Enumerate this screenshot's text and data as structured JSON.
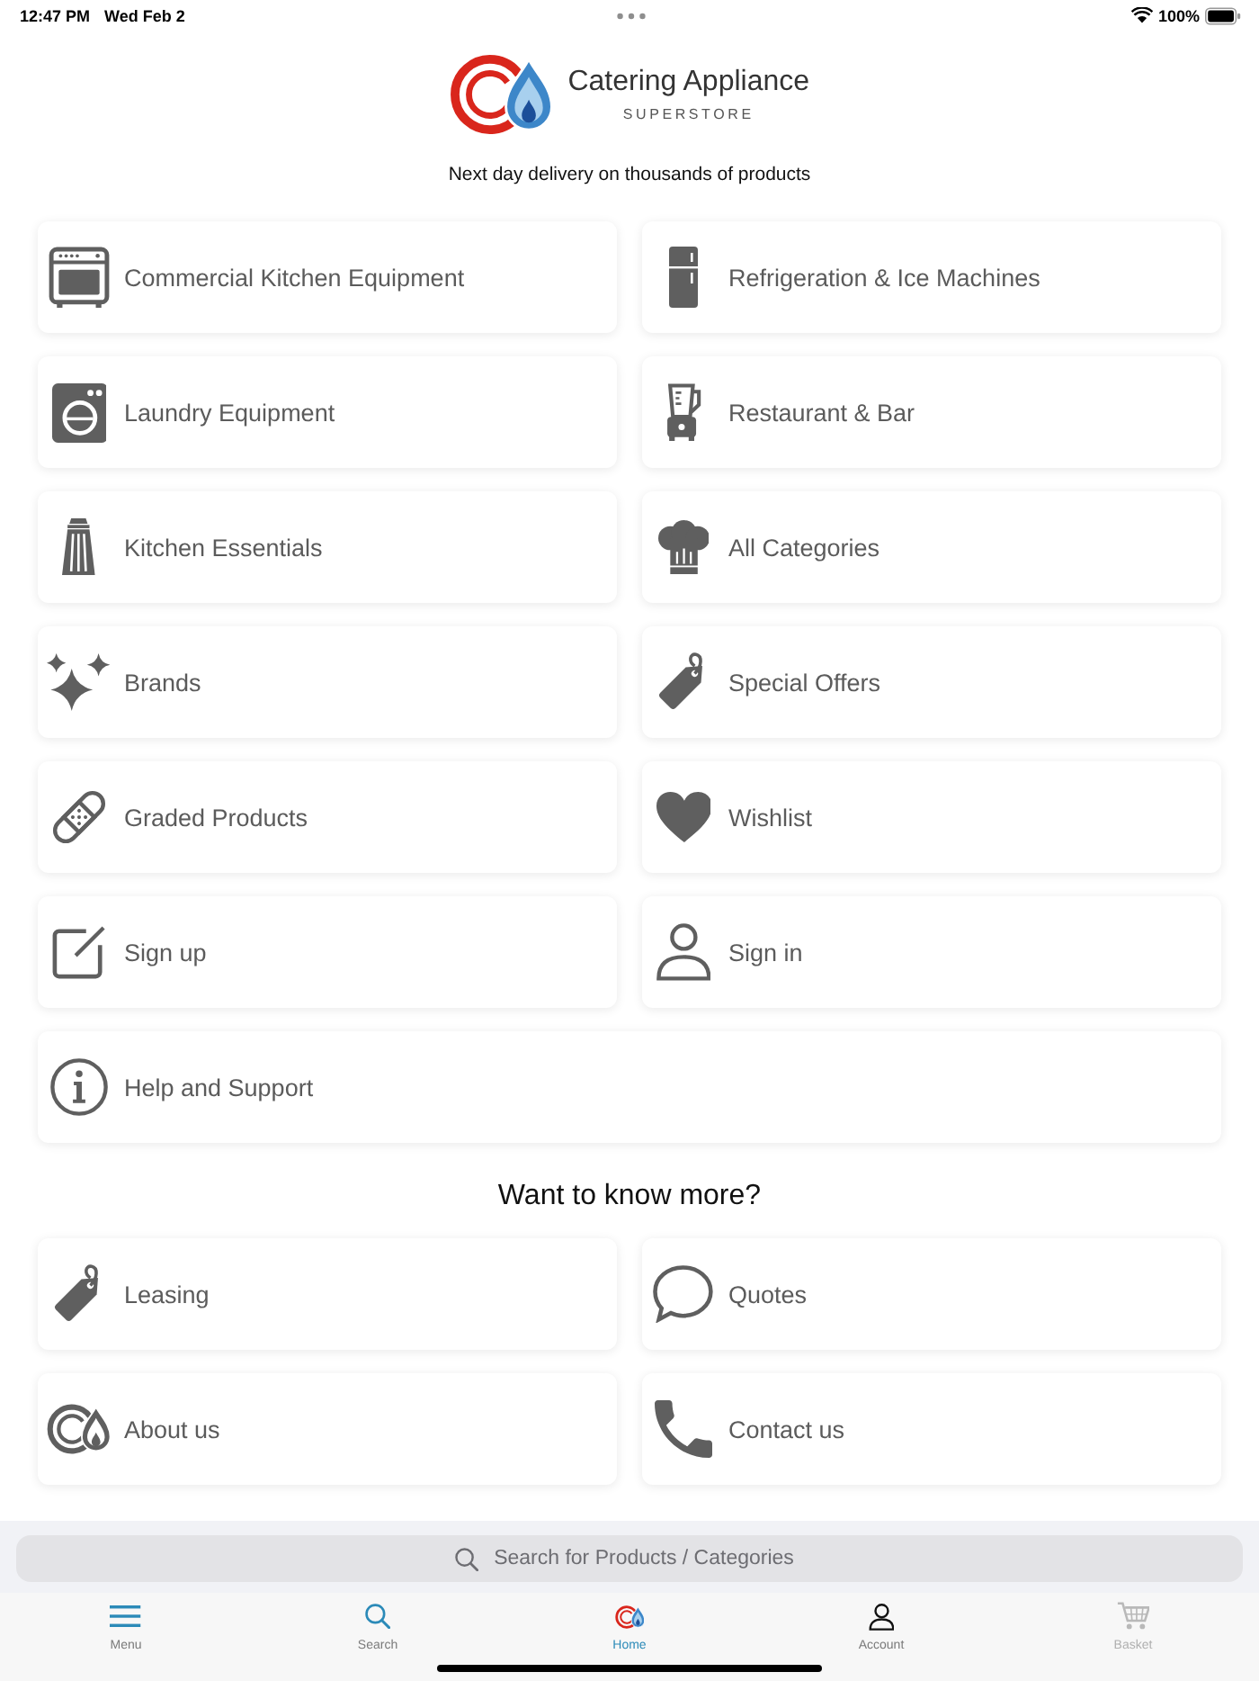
{
  "status_bar": {
    "time": "12:47 PM",
    "date": "Wed Feb 2",
    "battery": "100%"
  },
  "logo": {
    "title": "Catering Appliance",
    "subtitle": "SUPERSTORE"
  },
  "tagline": "Next day delivery on thousands of products",
  "menu": [
    {
      "label": "Commercial Kitchen Equipment",
      "kind": "oven",
      "full_width": false
    },
    {
      "label": "Refrigeration & Ice Machines",
      "kind": "fridge",
      "full_width": false
    },
    {
      "label": "Laundry Equipment",
      "kind": "washer",
      "full_width": false
    },
    {
      "label": "Restaurant & Bar",
      "kind": "blender",
      "full_width": false
    },
    {
      "label": "Kitchen Essentials",
      "kind": "shaker",
      "full_width": false
    },
    {
      "label": "All Categories",
      "kind": "chef-hat",
      "full_width": false
    },
    {
      "label": "Brands",
      "kind": "sparkles",
      "full_width": false
    },
    {
      "label": "Special Offers",
      "kind": "tag",
      "full_width": false
    },
    {
      "label": "Graded Products",
      "kind": "bandage",
      "full_width": false
    },
    {
      "label": "Wishlist",
      "kind": "heart",
      "full_width": false
    },
    {
      "label": "Sign up",
      "kind": "edit",
      "full_width": false
    },
    {
      "label": "Sign in",
      "kind": "person",
      "full_width": false
    },
    {
      "label": "Help and Support",
      "kind": "info",
      "full_width": true
    }
  ],
  "more": {
    "heading": "Want to know more?",
    "items": [
      {
        "label": "Leasing",
        "kind": "tag"
      },
      {
        "label": "Quotes",
        "kind": "speech"
      },
      {
        "label": "About us",
        "kind": "logo"
      },
      {
        "label": "Contact us",
        "kind": "phone"
      }
    ]
  },
  "search": {
    "placeholder": "Search for Products / Categories"
  },
  "tab_bar": [
    {
      "label": "Menu",
      "kind": "menu",
      "selected": false,
      "disabled": false
    },
    {
      "label": "Search",
      "kind": "search",
      "selected": false,
      "disabled": false
    },
    {
      "label": "Home",
      "kind": "home",
      "selected": true,
      "disabled": false
    },
    {
      "label": "Account",
      "kind": "account",
      "selected": false,
      "disabled": false
    },
    {
      "label": "Basket",
      "kind": "basket",
      "selected": false,
      "disabled": true
    }
  ]
}
